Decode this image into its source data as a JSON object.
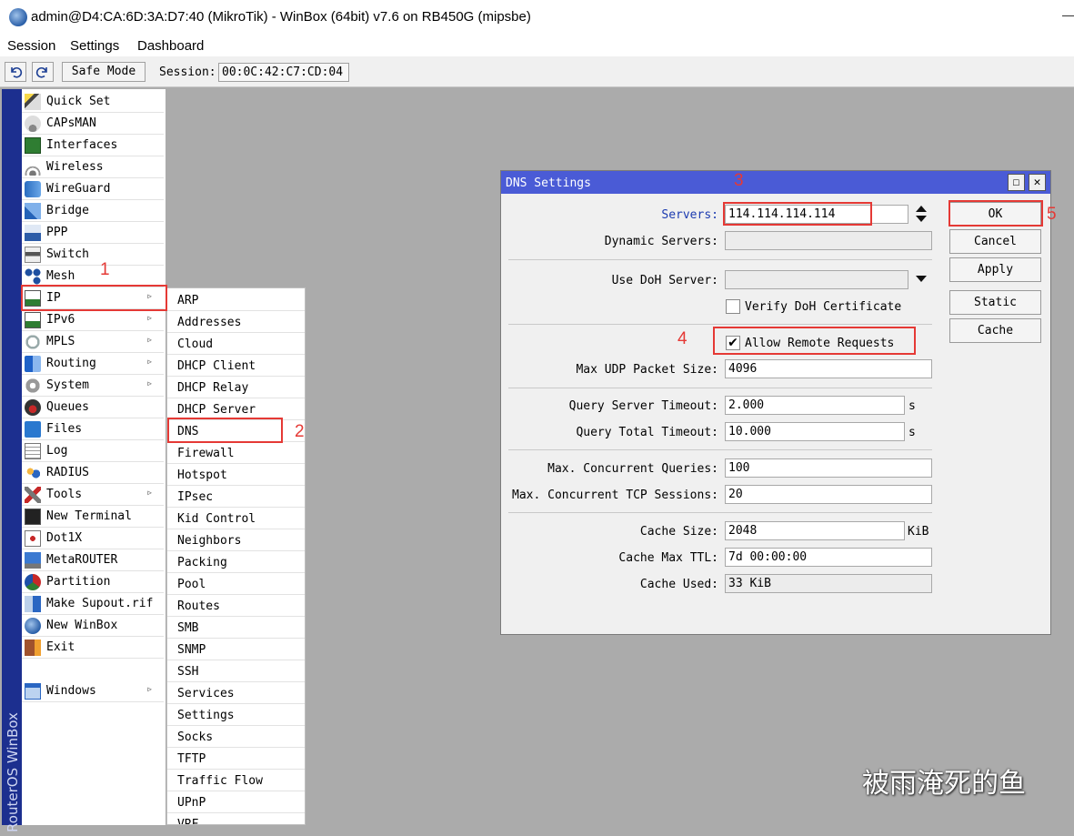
{
  "window": {
    "title": "admin@D4:CA:6D:3A:D7:40 (MikroTik) - WinBox (64bit) v7.6 on RB450G (mipsbe)"
  },
  "menubar": [
    "Session",
    "Settings",
    "Dashboard"
  ],
  "toolbar": {
    "undo_icon": "undo-icon",
    "redo_icon": "redo-icon",
    "safe_mode_label": "Safe Mode",
    "session_label": "Session:",
    "session_value": "00:0C:42:C7:CD:04"
  },
  "sidebar": {
    "vertical_label": "RouterOS WinBox",
    "items": [
      {
        "label": "Quick Set",
        "icon": "wand-icon",
        "sub": false
      },
      {
        "label": "CAPsMAN",
        "icon": "antenna-icon",
        "sub": false
      },
      {
        "label": "Interfaces",
        "icon": "network-card-icon",
        "sub": false
      },
      {
        "label": "Wireless",
        "icon": "wifi-icon",
        "sub": false
      },
      {
        "label": "WireGuard",
        "icon": "wireguard-icon",
        "sub": false
      },
      {
        "label": "Bridge",
        "icon": "bridge-icon",
        "sub": false
      },
      {
        "label": "PPP",
        "icon": "ppp-icon",
        "sub": false
      },
      {
        "label": "Switch",
        "icon": "switch-icon",
        "sub": false
      },
      {
        "label": "Mesh",
        "icon": "mesh-icon",
        "sub": false
      },
      {
        "label": "IP",
        "icon": "ip-icon",
        "sub": true
      },
      {
        "label": "IPv6",
        "icon": "ipv6-icon",
        "sub": true
      },
      {
        "label": "MPLS",
        "icon": "mpls-icon",
        "sub": true
      },
      {
        "label": "Routing",
        "icon": "routing-icon",
        "sub": true
      },
      {
        "label": "System",
        "icon": "gear-icon",
        "sub": true
      },
      {
        "label": "Queues",
        "icon": "gauge-icon",
        "sub": false
      },
      {
        "label": "Files",
        "icon": "folder-icon",
        "sub": false
      },
      {
        "label": "Log",
        "icon": "log-icon",
        "sub": false
      },
      {
        "label": "RADIUS",
        "icon": "users-icon",
        "sub": false
      },
      {
        "label": "Tools",
        "icon": "tools-icon",
        "sub": true
      },
      {
        "label": "New Terminal",
        "icon": "terminal-icon",
        "sub": false
      },
      {
        "label": "Dot1X",
        "icon": "dot1x-icon",
        "sub": false
      },
      {
        "label": "MetaROUTER",
        "icon": "monitor-icon",
        "sub": false
      },
      {
        "label": "Partition",
        "icon": "pie-icon",
        "sub": false
      },
      {
        "label": "Make Supout.rif",
        "icon": "export-icon",
        "sub": false
      },
      {
        "label": "New WinBox",
        "icon": "winbox-icon",
        "sub": false
      },
      {
        "label": "Exit",
        "icon": "exit-icon",
        "sub": false
      }
    ],
    "windows_item": {
      "label": "Windows",
      "icon": "window-icon",
      "sub": true
    }
  },
  "ip_submenu": [
    "ARP",
    "Addresses",
    "Cloud",
    "DHCP Client",
    "DHCP Relay",
    "DHCP Server",
    "DNS",
    "Firewall",
    "Hotspot",
    "IPsec",
    "Kid Control",
    "Neighbors",
    "Packing",
    "Pool",
    "Routes",
    "SMB",
    "SNMP",
    "SSH",
    "Services",
    "Settings",
    "Socks",
    "TFTP",
    "Traffic Flow",
    "UPnP",
    "VRF"
  ],
  "dns_dialog": {
    "title": "DNS Settings",
    "servers_label": "Servers:",
    "servers_value": "114.114.114.114",
    "dynamic_servers_label": "Dynamic Servers:",
    "dynamic_servers_value": "",
    "doh_server_label": "Use DoH Server:",
    "doh_server_value": "",
    "verify_doh_label": "Verify DoH Certificate",
    "verify_doh_checked": false,
    "allow_remote_label": "Allow Remote Requests",
    "allow_remote_checked": true,
    "max_udp_label": "Max UDP Packet Size:",
    "max_udp_value": "4096",
    "query_server_timeout_label": "Query Server Timeout:",
    "query_server_timeout_value": "2.000",
    "query_total_timeout_label": "Query Total Timeout:",
    "query_total_timeout_value": "10.000",
    "seconds_unit": "s",
    "max_concurrent_queries_label": "Max. Concurrent Queries:",
    "max_concurrent_queries_value": "100",
    "max_tcp_sessions_label": "Max. Concurrent TCP Sessions:",
    "max_tcp_sessions_value": "20",
    "cache_size_label": "Cache Size:",
    "cache_size_value": "2048",
    "cache_size_unit": "KiB",
    "cache_max_ttl_label": "Cache Max TTL:",
    "cache_max_ttl_value": "7d 00:00:00",
    "cache_used_label": "Cache Used:",
    "cache_used_value": "33 KiB",
    "buttons": {
      "ok": "OK",
      "cancel": "Cancel",
      "apply": "Apply",
      "static": "Static",
      "cache": "Cache"
    }
  },
  "annotations": [
    "1",
    "2",
    "3",
    "4",
    "5"
  ],
  "watermark": "被雨淹死的鱼",
  "colors": {
    "annotation_red": "#e53935",
    "dialog_title": "#4a5bd6",
    "sidebar_strip": "#1c2f8f",
    "servers_label": "#1c3bb0"
  }
}
